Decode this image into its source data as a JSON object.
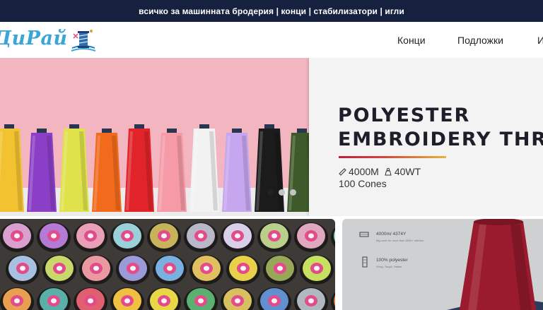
{
  "topbar": {
    "text": "всичко за  машинната бродерия | конци |  стабилизатори | игли"
  },
  "header": {
    "logo_text": "ДиРай",
    "nav": [
      "Конци",
      "Подложки",
      "И"
    ]
  },
  "hero": {
    "line1": "POLYESTER",
    "line2": "EMBROIDERY THREA",
    "spec_length": "4000M",
    "spec_weight": "40WT",
    "count": "100 Cones",
    "slides": {
      "total": 3,
      "active": 1
    },
    "spool_colors": [
      "#f2c230",
      "#8a3fc6",
      "#dfe24a",
      "#f26a1b",
      "#e0242a",
      "#f59aa6",
      "#f2f2f2",
      "#c6a6ee",
      "#1b1b1b",
      "#3f5a2a"
    ]
  },
  "panel_left": {
    "spool_colors": [
      "#d9a0cf",
      "#b57ad6",
      "#e8a0b8",
      "#9ad0d8",
      "#c9b35a",
      "#b8b8c8",
      "#d8d0e8",
      "#b8d08a",
      "#e0a8c0",
      "#8fd1c8",
      "#a8c0e0",
      "#c8d86a",
      "#e89aa0",
      "#9a9ad8",
      "#7ab0e0",
      "#e0c060",
      "#e8d04a",
      "#98a858",
      "#c8e060",
      "#b0d840",
      "#e8a050",
      "#5ab0a8",
      "#e06070",
      "#f0c040",
      "#e8d848",
      "#5ab070",
      "#d8c060",
      "#6090d0",
      "#b0b8c0",
      "#d88040"
    ]
  },
  "panel_right": {
    "spec1": "4000m/ 4374Y",
    "spec1_sub": "Big cone for more than 600k+ stitches",
    "spec2": "100% polyester",
    "spec2_sub": "Shiny, Tough, Stable",
    "spool_color": "#9b1b2e"
  }
}
